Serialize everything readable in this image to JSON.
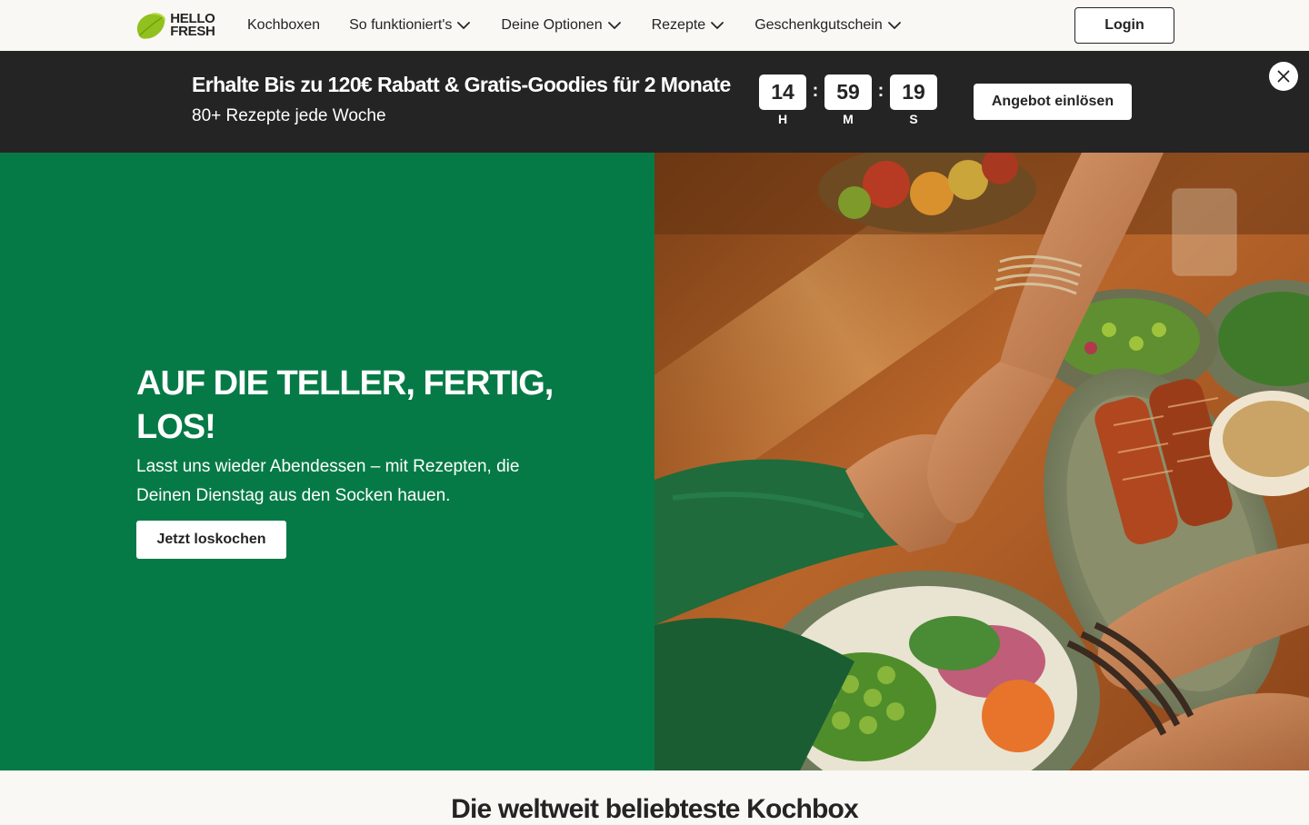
{
  "brand": {
    "logo_text_line1": "HELLO",
    "logo_text_line2": "FRESH",
    "accent_color": "#91c11e",
    "hero_green": "#067a46"
  },
  "nav": {
    "items": [
      {
        "label": "Kochboxen",
        "has_dropdown": false
      },
      {
        "label": "So funktioniert's",
        "has_dropdown": true
      },
      {
        "label": "Deine Optionen",
        "has_dropdown": true
      },
      {
        "label": "Rezepte",
        "has_dropdown": true
      },
      {
        "label": "Geschenkgutschein",
        "has_dropdown": true
      }
    ],
    "login_label": "Login"
  },
  "promo": {
    "title": "Erhalte Bis zu 120€ Rabatt & Gratis-Goodies für 2 Monate",
    "subtitle": "80+ Rezepte jede Woche",
    "countdown": {
      "hours": "14",
      "minutes": "59",
      "seconds": "19",
      "hours_label": "H",
      "minutes_label": "M",
      "seconds_label": "S",
      "separator": ":"
    },
    "cta_label": "Angebot einlösen",
    "close_icon": "close-icon"
  },
  "hero": {
    "title": "Auf die Teller, fertig, los!",
    "subtitle": "Lasst uns wieder Abendessen – mit Rezepten, die Deinen Dienstag aus den Socken hauen.",
    "cta_label": "Jetzt loskochen"
  },
  "next_section": {
    "heading": "Die weltweit beliebteste Kochbox"
  }
}
